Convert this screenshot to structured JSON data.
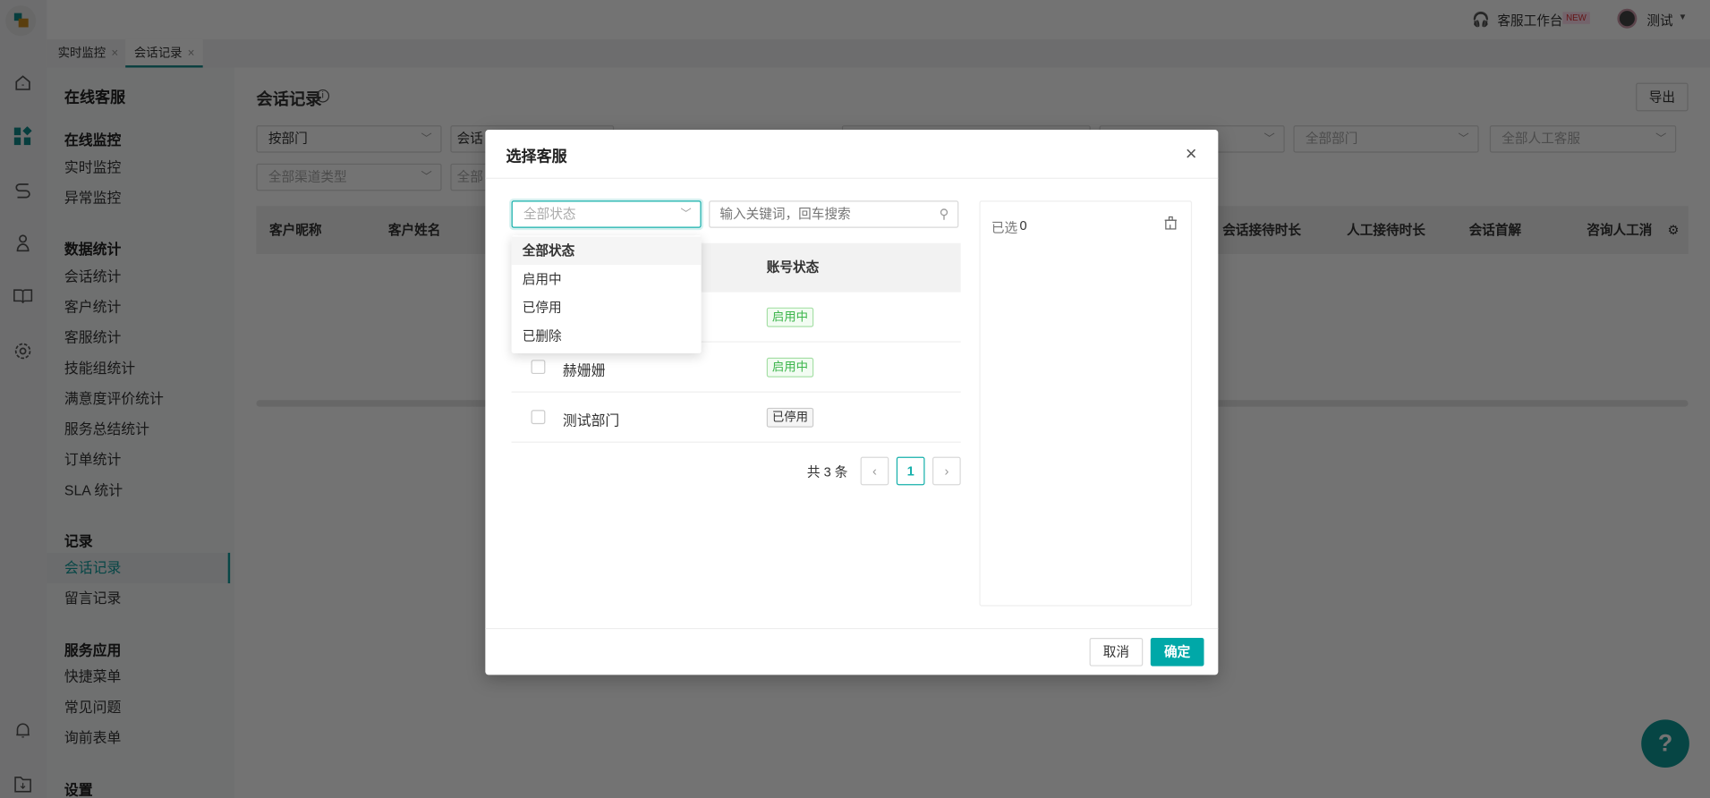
{
  "header": {
    "workbench": "客服工作台",
    "new_badge": "NEW",
    "user": "测试"
  },
  "tabs": [
    {
      "label": "实时监控"
    },
    {
      "label": "会话记录"
    }
  ],
  "sidebar": {
    "title": "在线客服",
    "groups": [
      {
        "label": "在线监控",
        "items": [
          "实时监控",
          "异常监控"
        ]
      },
      {
        "label": "数据统计",
        "items": [
          "会话统计",
          "客户统计",
          "客服统计",
          "技能组统计",
          "满意度评价统计",
          "服务总结统计",
          "订单统计",
          "SLA 统计"
        ]
      },
      {
        "label": "记录",
        "items": [
          "会话记录",
          "留言记录"
        ]
      },
      {
        "label": "服务应用",
        "items": [
          "快捷菜单",
          "常见问题",
          "询前表单"
        ]
      },
      {
        "label": "设置",
        "items": []
      }
    ],
    "active": "会话记录"
  },
  "main": {
    "title": "会话记录",
    "export": "导出",
    "filters": [
      "按部门",
      "会话",
      "全部部门",
      "全部人工客服",
      "全部渠道类型",
      "全部"
    ],
    "columns": [
      "客户昵称",
      "客户姓名",
      "会话接待时长",
      "人工接待时长",
      "会话首解",
      "咨询人工消"
    ]
  },
  "dialog": {
    "title": "选择客服",
    "status_select": "全部状态",
    "search_placeholder": "输入关键词，回车搜索",
    "col_status": "账号状态",
    "rows": [
      {
        "name": "",
        "status": "启用中"
      },
      {
        "name": "赫姗姗",
        "status": "启用中"
      },
      {
        "name": "测试部门",
        "status": "已停用"
      }
    ],
    "total": "共 3 条",
    "page": "1",
    "selected_label": "已选",
    "selected_count": "0",
    "cancel": "取消",
    "confirm": "确定",
    "dropdown": [
      "全部状态",
      "启用中",
      "已停用",
      "已删除"
    ]
  },
  "colors": {
    "accent": "#00a8a8"
  }
}
